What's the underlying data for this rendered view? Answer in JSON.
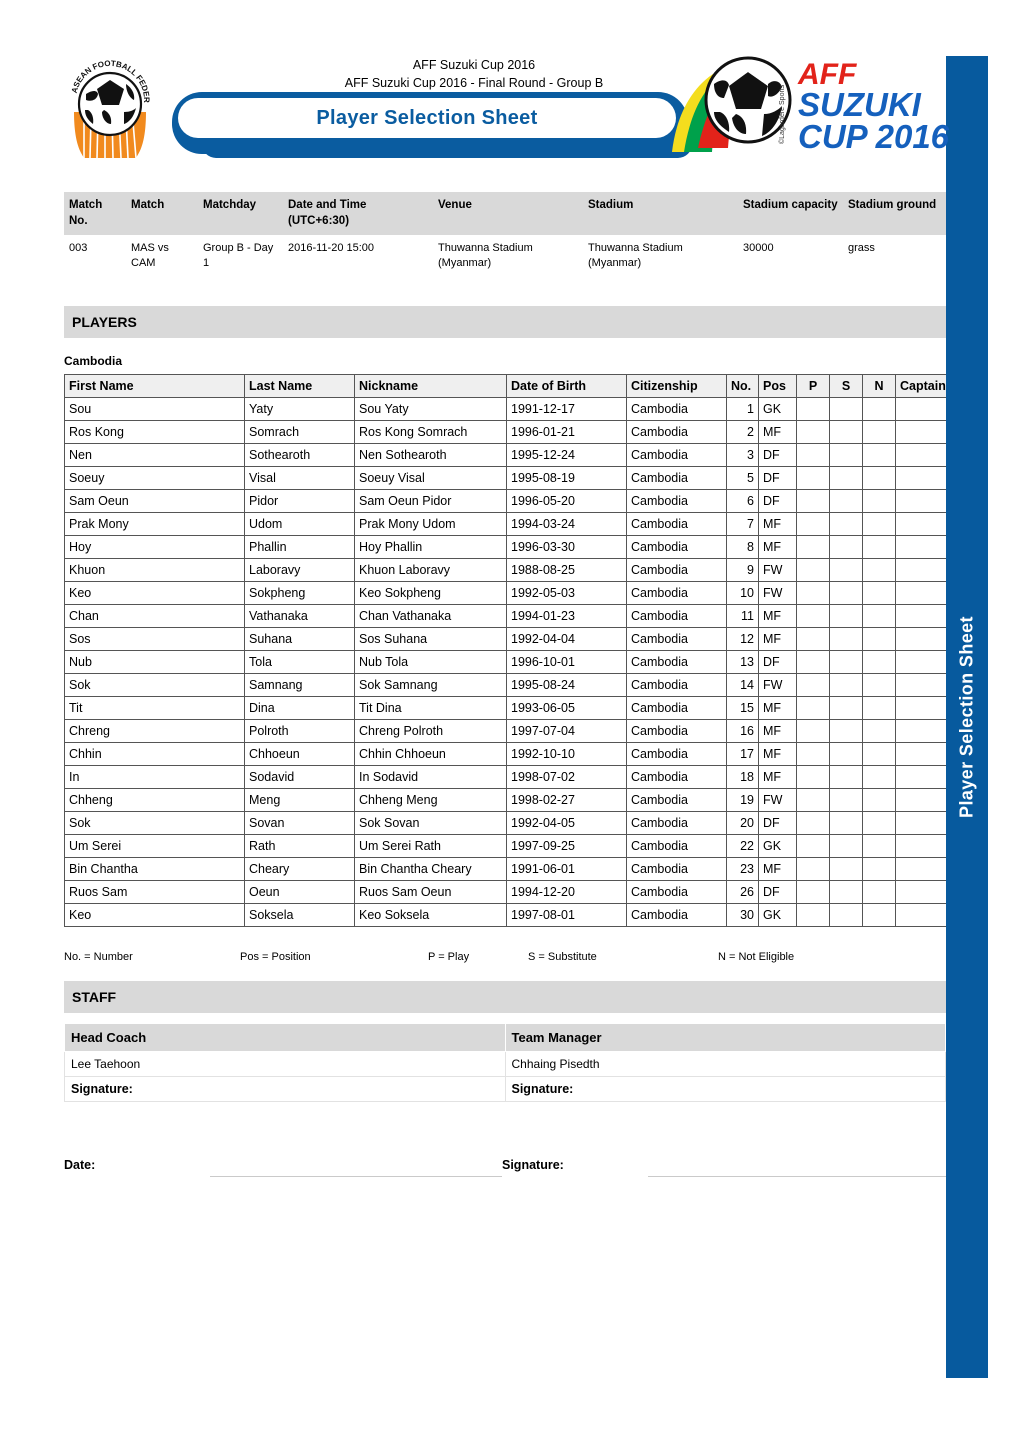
{
  "document": {
    "title": "Player Selection Sheet",
    "competition_line1": "AFF Suzuki Cup 2016",
    "competition_line2": "AFF Suzuki Cup 2016 - Final Round - Group B",
    "side_tab_label": "Player Selection Sheet",
    "accent_blue": "#0A5CA0",
    "grey_band": "#D9D9D9"
  },
  "logos": {
    "federation_alt": "ASEAN Football Federation",
    "federation_arc_text": "ASEAN FOOTBALL FEDERATION",
    "cup_line1": "AFF",
    "cup_line2": "SUZUKI",
    "cup_line3": "CUP",
    "cup_year": "2016",
    "cup_credit": "©Lagardère Sports"
  },
  "match_table": {
    "headers": [
      "Match No.",
      "Match",
      "Matchday",
      "Date and Time (UTC+6:30)",
      "Venue",
      "Stadium",
      "Stadium capacity",
      "Stadium ground"
    ],
    "row": [
      "003",
      "MAS vs CAM",
      "Group B - Day 1",
      "2016-11-20 15:00",
      "Thuwanna Stadium (Myanmar)",
      "Thuwanna Stadium (Myanmar)",
      "30000",
      "grass"
    ]
  },
  "players_section": {
    "heading": "PLAYERS",
    "team": "Cambodia",
    "headers": [
      "First Name",
      "Last Name",
      "Nickname",
      "Date of Birth",
      "Citizenship",
      "No.",
      "Pos",
      "P",
      "S",
      "N",
      "Captain"
    ],
    "rows": [
      [
        "Sou",
        "Yaty",
        "Sou Yaty",
        "1991-12-17",
        "Cambodia",
        "1",
        "GK",
        "",
        "",
        "",
        ""
      ],
      [
        "Ros Kong",
        "Somrach",
        "Ros Kong Somrach",
        "1996-01-21",
        "Cambodia",
        "2",
        "MF",
        "",
        "",
        "",
        ""
      ],
      [
        "Nen",
        "Sothearoth",
        "Nen Sothearoth",
        "1995-12-24",
        "Cambodia",
        "3",
        "DF",
        "",
        "",
        "",
        ""
      ],
      [
        "Soeuy",
        "Visal",
        "Soeuy Visal",
        "1995-08-19",
        "Cambodia",
        "5",
        "DF",
        "",
        "",
        "",
        ""
      ],
      [
        "Sam Oeun",
        "Pidor",
        "Sam Oeun Pidor",
        "1996-05-20",
        "Cambodia",
        "6",
        "DF",
        "",
        "",
        "",
        ""
      ],
      [
        "Prak Mony",
        "Udom",
        "Prak Mony Udom",
        "1994-03-24",
        "Cambodia",
        "7",
        "MF",
        "",
        "",
        "",
        ""
      ],
      [
        "Hoy",
        "Phallin",
        "Hoy Phallin",
        "1996-03-30",
        "Cambodia",
        "8",
        "MF",
        "",
        "",
        "",
        ""
      ],
      [
        "Khuon",
        "Laboravy",
        "Khuon Laboravy",
        "1988-08-25",
        "Cambodia",
        "9",
        "FW",
        "",
        "",
        "",
        ""
      ],
      [
        "Keo",
        "Sokpheng",
        "Keo Sokpheng",
        "1992-05-03",
        "Cambodia",
        "10",
        "FW",
        "",
        "",
        "",
        ""
      ],
      [
        "Chan",
        "Vathanaka",
        "Chan Vathanaka",
        "1994-01-23",
        "Cambodia",
        "11",
        "MF",
        "",
        "",
        "",
        ""
      ],
      [
        "Sos",
        "Suhana",
        "Sos Suhana",
        "1992-04-04",
        "Cambodia",
        "12",
        "MF",
        "",
        "",
        "",
        ""
      ],
      [
        "Nub",
        "Tola",
        "Nub Tola",
        "1996-10-01",
        "Cambodia",
        "13",
        "DF",
        "",
        "",
        "",
        ""
      ],
      [
        "Sok",
        "Samnang",
        "Sok Samnang",
        "1995-08-24",
        "Cambodia",
        "14",
        "FW",
        "",
        "",
        "",
        ""
      ],
      [
        "Tit",
        "Dina",
        "Tit Dina",
        "1993-06-05",
        "Cambodia",
        "15",
        "MF",
        "",
        "",
        "",
        ""
      ],
      [
        "Chreng",
        "Polroth",
        "Chreng Polroth",
        "1997-07-04",
        "Cambodia",
        "16",
        "MF",
        "",
        "",
        "",
        ""
      ],
      [
        "Chhin",
        "Chhoeun",
        "Chhin Chhoeun",
        "1992-10-10",
        "Cambodia",
        "17",
        "MF",
        "",
        "",
        "",
        ""
      ],
      [
        "In",
        "Sodavid",
        "In  Sodavid",
        "1998-07-02",
        "Cambodia",
        "18",
        "MF",
        "",
        "",
        "",
        ""
      ],
      [
        "Chheng",
        "Meng",
        "Chheng  Meng",
        "1998-02-27",
        "Cambodia",
        "19",
        "FW",
        "",
        "",
        "",
        ""
      ],
      [
        "Sok",
        "Sovan",
        "Sok Sovan",
        "1992-04-05",
        "Cambodia",
        "20",
        "DF",
        "",
        "",
        "",
        ""
      ],
      [
        "Um Serei",
        "Rath",
        "Um Serei Rath",
        "1997-09-25",
        "Cambodia",
        "22",
        "GK",
        "",
        "",
        "",
        ""
      ],
      [
        "Bin Chantha",
        "Cheary",
        "Bin Chantha Cheary",
        "1991-06-01",
        "Cambodia",
        "23",
        "MF",
        "",
        "",
        "",
        ""
      ],
      [
        "Ruos Sam",
        "Oeun",
        "Ruos Sam Oeun",
        "1994-12-20",
        "Cambodia",
        "26",
        "DF",
        "",
        "",
        "",
        ""
      ],
      [
        "Keo",
        "Soksela",
        "Keo  Soksela",
        "1997-08-01",
        "Cambodia",
        "30",
        "GK",
        "",
        "",
        "",
        ""
      ]
    ]
  },
  "legend": [
    "No. = Number",
    "Pos  = Position",
    "P = Play",
    "S = Substitute",
    "N = Not Eligible"
  ],
  "staff_section": {
    "heading": "STAFF",
    "head_coach_label": "Head Coach",
    "head_coach_name": "Lee Taehoon",
    "head_coach_signature_label": "Signature:",
    "team_manager_label": "Team Manager",
    "team_manager_name": "Chhaing Pisedth",
    "team_manager_signature_label": "Signature:"
  },
  "footer": {
    "date_label": "Date:",
    "date_value": "",
    "signature_label": "Signature:",
    "signature_value": ""
  }
}
